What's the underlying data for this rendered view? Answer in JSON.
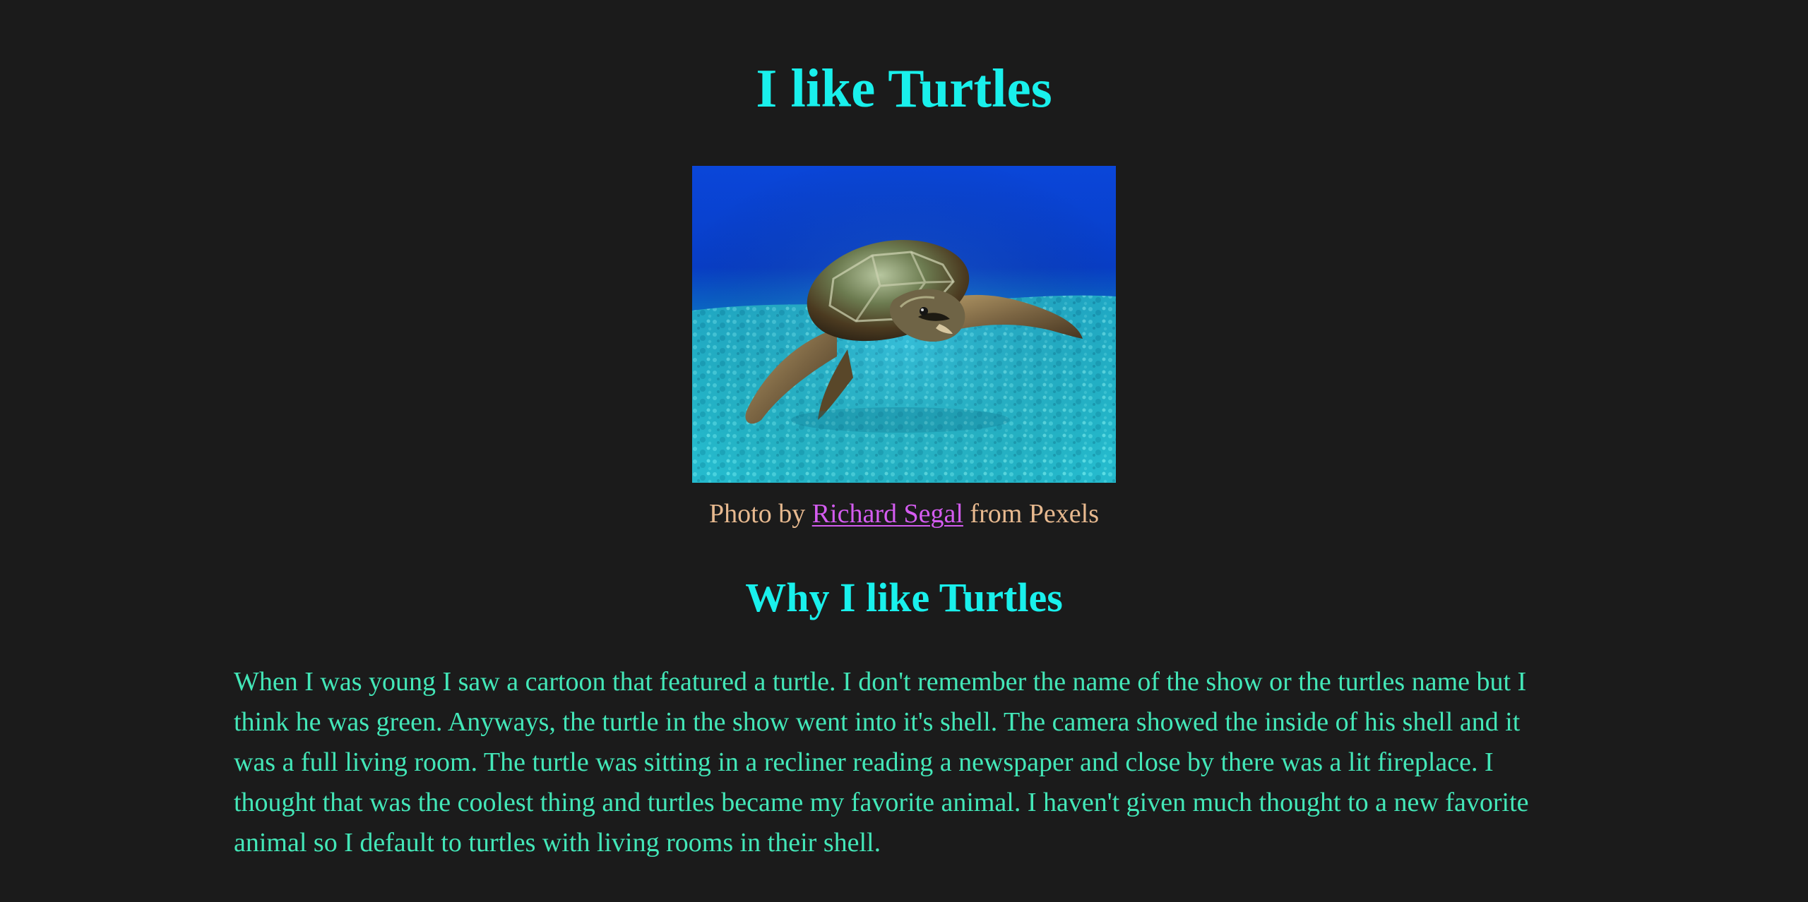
{
  "page": {
    "title": "I like Turtles",
    "colors": {
      "background": "#1b1b1b",
      "heading": "#19f0ec",
      "caption": "#e7b98f",
      "link": "#d45cf0",
      "paragraph": "#43e7b8"
    }
  },
  "hero": {
    "image_subject": "sea turtle swimming over ocean floor",
    "caption_prefix": "Photo by ",
    "caption_link": "Richard Segal",
    "caption_suffix": " from Pexels"
  },
  "section": {
    "heading": "Why I like Turtles",
    "paragraph": "When I was young I saw a cartoon that featured a turtle. I don't remember the name of the show or the turtles name but I think he was green. Anyways, the turtle in the show went into it's shell. The camera showed the inside of his shell and it was a full living room. The turtle was sitting in a recliner reading a newspaper and close by there was a lit fireplace. I thought that was the coolest thing and turtles became my favorite animal. I haven't given much thought to a new favorite animal so I default to turtles with living rooms in their shell."
  }
}
